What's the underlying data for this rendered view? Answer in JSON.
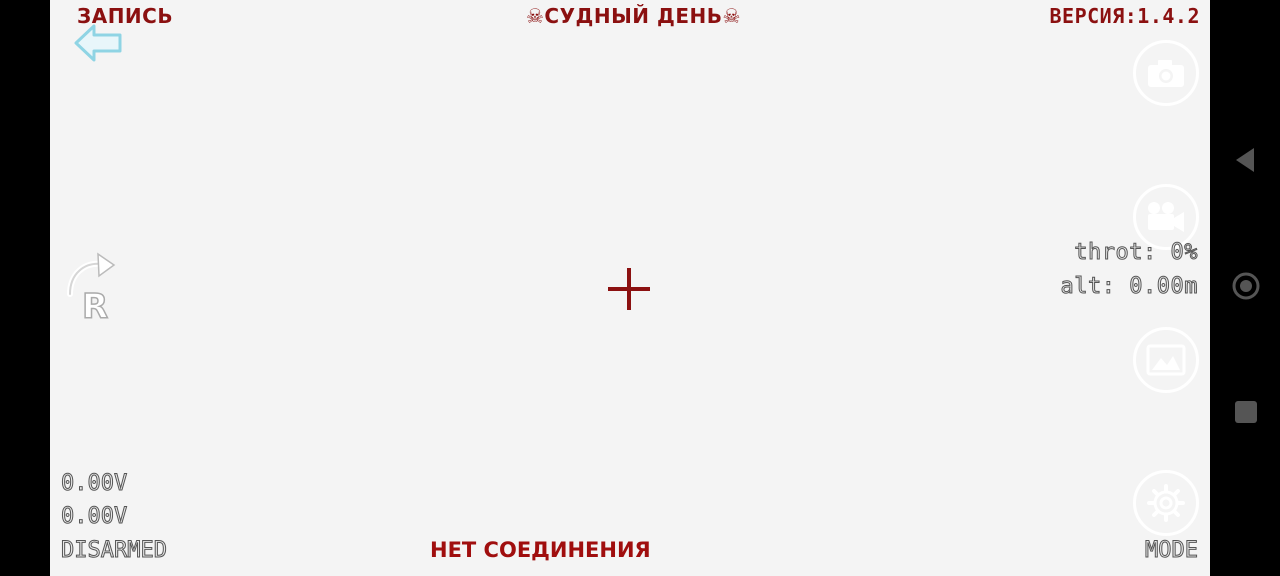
{
  "header": {
    "record_label": "ЗАПИСЬ",
    "title": "☠СУДНЫЙ ДЕНЬ☠",
    "version": "ВЕРСИЯ:1.4.2"
  },
  "telemetry": {
    "throttle": "throt: 0%",
    "altitude": "alt: 0.00m"
  },
  "battery": {
    "voltage1": "0.00V",
    "voltage2": "0.00V"
  },
  "status": {
    "arm_state": "DISARMED",
    "connection": "НЕТ СОЕДИНЕНИЯ",
    "mode_label": "MODE"
  },
  "icons": {
    "back": "back-arrow-icon",
    "rotate": "rotate-right-icon",
    "rotate_letter": "R",
    "crosshair": "crosshair-icon",
    "camera": "camera-icon",
    "video": "video-camera-icon",
    "gallery": "gallery-icon",
    "settings": "gear-icon"
  },
  "colors": {
    "accent_red": "#8b1010",
    "background": "#f4f4f4",
    "back_arrow": "#8fd4e4"
  }
}
